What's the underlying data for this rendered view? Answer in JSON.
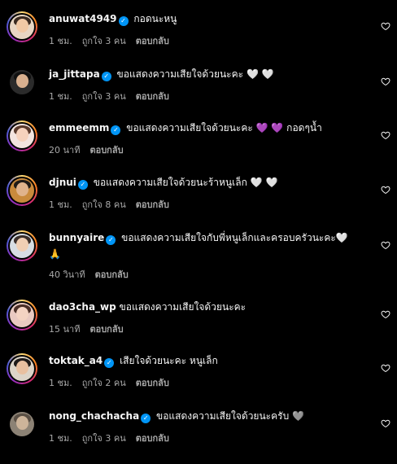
{
  "comments": [
    {
      "username": "anuwat4949",
      "verified": true,
      "text": "กอดนะหนู",
      "emojis": "",
      "time": "1 ชม.",
      "likes": "ถูกใจ 3 คน",
      "reply": "ตอบกลับ"
    },
    {
      "username": "ja_jittapa",
      "verified": true,
      "text": "ขอแสดงความเสียใจด้วยนะคะ",
      "emojis": "🤍 🤍",
      "time": "1 ชม.",
      "likes": "ถูกใจ 3 คน",
      "reply": "ตอบกลับ"
    },
    {
      "username": "emmeemm",
      "verified": true,
      "text": "ขอแสดงความเสียใจด้วยนะคะ",
      "emojis": "💜 💜 กอดๆน้ำ",
      "time": "20 นาที",
      "likes": "",
      "reply": "ตอบกลับ"
    },
    {
      "username": "djnui",
      "verified": true,
      "text": "ขอแสดงความเสียใจด้วยนะร้าหนูเล็ก",
      "emojis": "🤍 🤍",
      "time": "1 ชม.",
      "likes": "ถูกใจ 8 คน",
      "reply": "ตอบกลับ"
    },
    {
      "username": "bunnyaire",
      "verified": true,
      "text": "ขอแสดงความเสียใจกับพี่หนูเล็กและครอบครัวนะคะ",
      "emojis": "🤍",
      "line2": "🙏",
      "time": "40 วินาที",
      "likes": "",
      "reply": "ตอบกลับ"
    },
    {
      "username": "dao3cha_wp",
      "verified": false,
      "text": "ขอแสดงความเสียใจด้วยนะคะ",
      "emojis": "",
      "time": "15 นาที",
      "likes": "",
      "reply": "ตอบกลับ"
    },
    {
      "username": "toktak_a4",
      "verified": true,
      "text": "เสียใจด้วยนะคะ หนูเล็ก",
      "emojis": "",
      "time": "1 ชม.",
      "likes": "ถูกใจ 2 คน",
      "reply": "ตอบกลับ"
    },
    {
      "username": "nong_chachacha",
      "verified": true,
      "text": "ขอแสดงความเสียใจด้วยนะครับ",
      "emojis": "🩶",
      "time": "1 ชม.",
      "likes": "ถูกใจ 3 คน",
      "reply": "ตอบกลับ"
    }
  ],
  "icons": {
    "verified": "✓",
    "like": "heart-outline-icon"
  },
  "colors": {
    "background": "#000000",
    "text": "#f5f5f5",
    "secondary_text": "#a8a8a8",
    "verified_badge": "#0095f6",
    "story_ring": [
      "#feda75",
      "#fa7e1e",
      "#d62976",
      "#962fbf",
      "#4f5bd5"
    ]
  }
}
